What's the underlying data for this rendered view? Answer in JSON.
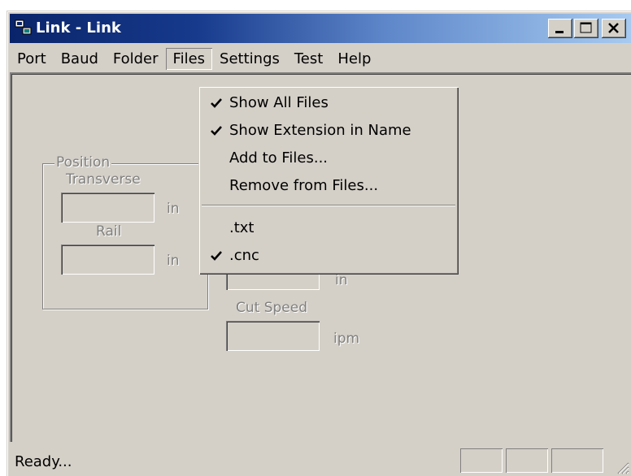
{
  "window": {
    "title": "Link - Link"
  },
  "menubar": {
    "items": [
      {
        "label": "Port"
      },
      {
        "label": "Baud"
      },
      {
        "label": "Folder"
      },
      {
        "label": "Files"
      },
      {
        "label": "Settings"
      },
      {
        "label": "Test"
      },
      {
        "label": "Help"
      }
    ]
  },
  "files_menu": {
    "items": [
      {
        "label": "Show All Files",
        "checked": true
      },
      {
        "label": "Show Extension in Name",
        "checked": true
      },
      {
        "label": "Add to Files...",
        "checked": false
      },
      {
        "label": "Remove from Files...",
        "checked": false
      },
      {
        "label": ".txt",
        "checked": false
      },
      {
        "label": ".cnc",
        "checked": true
      }
    ]
  },
  "position": {
    "group_label": "Position",
    "transverse_label": "Transverse",
    "transverse_unit": "in",
    "rail_label": "Rail",
    "rail_unit": "in"
  },
  "right_fields": {
    "hidden_unit": "in",
    "cut_speed_label": "Cut Speed",
    "cut_speed_unit": "ipm"
  },
  "statusbar": {
    "text": "Ready..."
  }
}
